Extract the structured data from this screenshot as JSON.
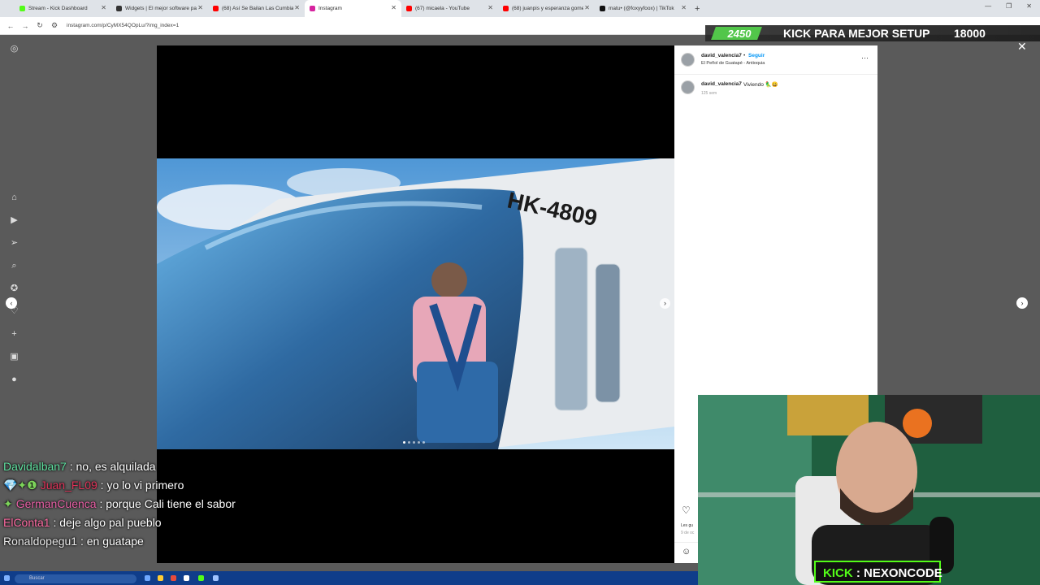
{
  "browser": {
    "tabs": [
      {
        "title": "Stream - Kick Dashboard",
        "color": "#53fc18",
        "active": false
      },
      {
        "title": "Widgets | El mejor software par",
        "color": "#333333",
        "active": false
      },
      {
        "title": "(68) Así Se Bailan Las Cumbias",
        "color": "#ff0000",
        "active": false
      },
      {
        "title": "Instagram",
        "color": "#d6249f",
        "active": true
      },
      {
        "title": "(67) micaela - YouTube",
        "color": "#ff0000",
        "active": false
      },
      {
        "title": "(68) juanpis y esperanza gomez",
        "color": "#ff0000",
        "active": false
      },
      {
        "title": "matu• (@foxyyfoox) | TikTok",
        "color": "#111111",
        "active": false
      }
    ],
    "new_tab_label": "+",
    "url": "instagram.com/p/CyMX54QOpLu/?img_index=1"
  },
  "overlay": {
    "goal_current": "2450",
    "goal_message": "KICK PARA MEJOR SETUP",
    "goal_target": "18000",
    "goal_progress": 0.136
  },
  "post": {
    "username": "david_valencia7",
    "separator": "•",
    "follow_label": "Seguir",
    "location": "El Peñol de Guatapé - Antioquia",
    "more_label": "···",
    "caption_user": "david_valencia7",
    "caption_text": "Viviendo 🦜😀",
    "caption_time": "125 sem",
    "likes_line": "Les gu",
    "date_line": "9 de oc",
    "image_count": 5,
    "current_image": 1
  },
  "chat": [
    {
      "user": "Davidalban7",
      "badges": "",
      "text": " : no, es alquilada"
    },
    {
      "user": "Juan_FL09",
      "badges": "💎✦❶",
      "text": " : yo lo vi primero"
    },
    {
      "user": "GermanCuenca",
      "badges": "✦",
      "text": " : porque Cali tiene el sabor"
    },
    {
      "user": "ElConta1",
      "badges": "",
      "text": " : deje algo pal pueblo"
    },
    {
      "user": "Ronaldopegu1",
      "badges": "",
      "text": " : en guatape"
    }
  ],
  "webcam": {
    "badge_prefix": "KICK",
    "badge_sep": ":",
    "badge_name": "NEXONCODE"
  },
  "taskbar": {
    "search_placeholder": "Buscar"
  },
  "photo": {
    "registration": "HK-4809"
  }
}
